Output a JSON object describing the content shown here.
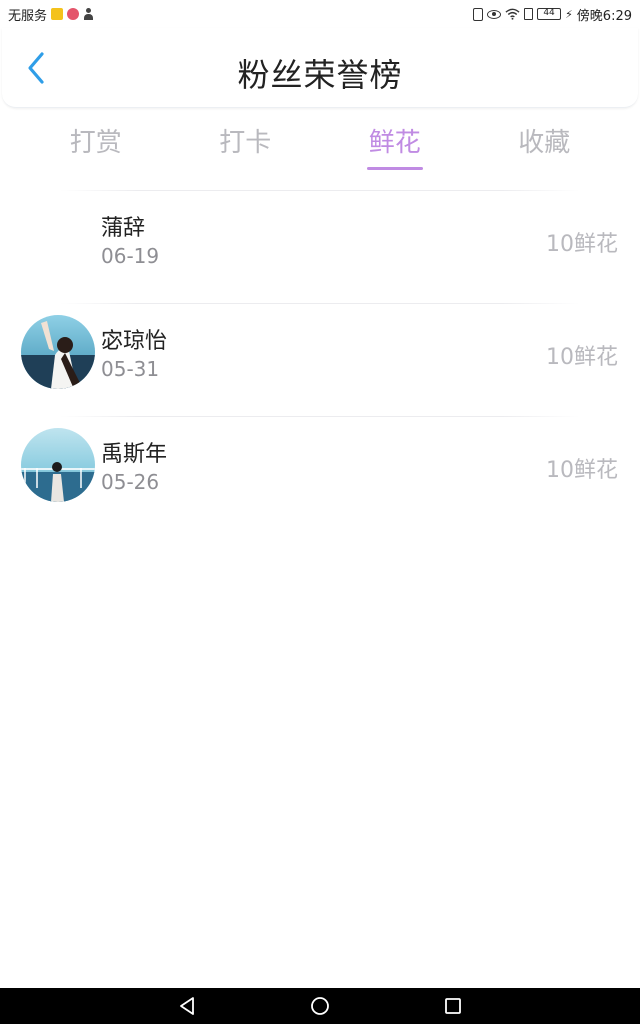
{
  "status_bar": {
    "carrier": "无服务",
    "battery": "44",
    "time": "傍晚6:29",
    "icons": [
      "sim-card-icon",
      "app-badge-icon",
      "person-icon",
      "vibrate-icon",
      "eye-icon",
      "wifi-icon",
      "sim-slot-icon",
      "battery-icon",
      "charging-bolt-icon"
    ]
  },
  "header": {
    "title": "粉丝荣誉榜",
    "back_icon": "chevron-left-icon",
    "accent_color": "#2f9ee8"
  },
  "tabs": [
    {
      "label": "打赏",
      "active": false
    },
    {
      "label": "打卡",
      "active": false
    },
    {
      "label": "鲜花",
      "active": true
    },
    {
      "label": "收藏",
      "active": false
    }
  ],
  "tab_active_color": "#c08be3",
  "fans": [
    {
      "name": "蒲辞",
      "date": "06-19",
      "amount": "10鲜花",
      "avatar": "none"
    },
    {
      "name": "宓琼怡",
      "date": "05-31",
      "amount": "10鲜花",
      "avatar": "girl-photo-avatar"
    },
    {
      "name": "禹斯年",
      "date": "05-26",
      "amount": "10鲜花",
      "avatar": "sea-photo-avatar"
    }
  ],
  "nav_bar": {
    "icons": [
      "back-triangle-icon",
      "home-circle-icon",
      "recents-square-icon"
    ]
  }
}
